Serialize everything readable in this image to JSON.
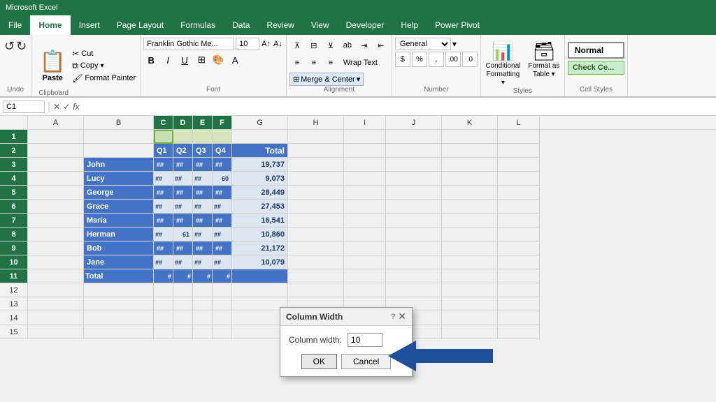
{
  "app": {
    "title": "Microsoft Excel"
  },
  "ribbon": {
    "tabs": [
      "File",
      "Home",
      "Insert",
      "Page Layout",
      "Formulas",
      "Data",
      "Review",
      "View",
      "Developer",
      "Help",
      "Power Pivot"
    ],
    "active_tab": "Home"
  },
  "clipboard_group": {
    "label": "Clipboard",
    "paste_label": "Paste",
    "cut_label": "Cut",
    "copy_label": "Copy",
    "format_painter_label": "Format Painter"
  },
  "font_group": {
    "label": "Font",
    "font_name": "Franklin Gothic Me...",
    "font_size": "10",
    "bold": "B",
    "italic": "I",
    "underline": "U"
  },
  "alignment_group": {
    "label": "Alignment",
    "wrap_text": "Wrap Text",
    "merge_center": "Merge & Center"
  },
  "number_group": {
    "label": "Number",
    "format": "General",
    "dollar": "$",
    "percent": "%",
    "comma": ","
  },
  "styles_group": {
    "label": "Styles",
    "conditional_formatting": "Conditional\nFormatting",
    "format_as_table": "Format as\nTable",
    "normal_style": "Normal",
    "check_cell_style": "Check Ce..."
  },
  "formula_bar": {
    "name_box": "C1",
    "formula": ""
  },
  "columns": [
    "A",
    "B",
    "C",
    "D",
    "E",
    "F",
    "G",
    "H",
    "I",
    "J",
    "K",
    "L"
  ],
  "rows": [
    1,
    2,
    3,
    4,
    5,
    6,
    7,
    8,
    9,
    10,
    11,
    12,
    13,
    14,
    15
  ],
  "spreadsheet_data": {
    "headers": [
      "Q1",
      "Q2",
      "Q3",
      "Q4",
      "Total"
    ],
    "rows": [
      {
        "name": "John",
        "q1": "##",
        "q2": "##",
        "q3": "##",
        "q4": "##",
        "total": "19,737"
      },
      {
        "name": "Lucy",
        "q1": "##",
        "q2": "##",
        "q3": "##",
        "q4": "60",
        "total": "9,073"
      },
      {
        "name": "George",
        "q1": "##",
        "q2": "##",
        "q3": "##",
        "q4": "##",
        "total": "28,449"
      },
      {
        "name": "Grace",
        "q1": "##",
        "q2": "##",
        "q3": "##",
        "q4": "##",
        "total": "27,453"
      },
      {
        "name": "Maria",
        "q1": "##",
        "q2": "##",
        "q3": "##",
        "q4": "##",
        "total": "16,541"
      },
      {
        "name": "Herman",
        "q1": "##",
        "q2": "61",
        "q3": "##",
        "q4": "##",
        "total": "10,860"
      },
      {
        "name": "Bob",
        "q1": "##",
        "q2": "##",
        "q3": "##",
        "q4": "##",
        "total": "21,172"
      },
      {
        "name": "Jane",
        "q1": "##",
        "q2": "##",
        "q3": "##",
        "q4": "##",
        "total": "10,079"
      },
      {
        "name": "Total",
        "q1": "#",
        "q2": "#",
        "q3": "#",
        "q4": "#",
        "total": ""
      }
    ]
  },
  "dialog": {
    "title": "Column Width",
    "label": "Column width:",
    "value": "10",
    "ok_label": "OK",
    "cancel_label": "Cancel"
  },
  "colors": {
    "blue_header": "#4472c4",
    "light_blue": "#dce6f1",
    "green_accent": "#217346",
    "selected_col": "#d6e4bc",
    "arrow_blue": "#1f4e9a"
  }
}
